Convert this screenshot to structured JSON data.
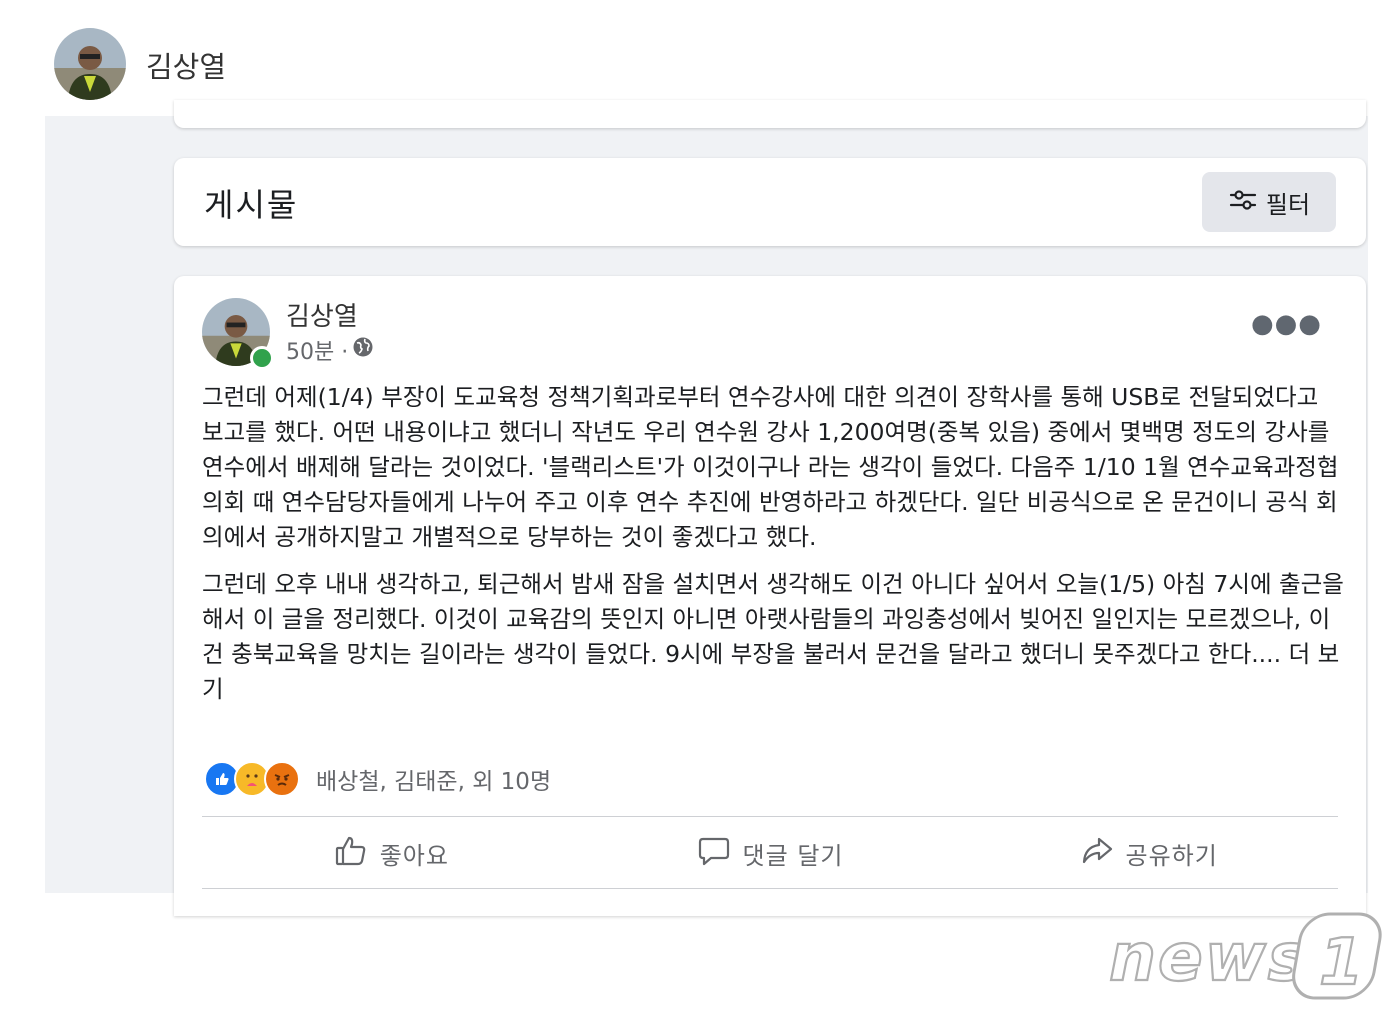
{
  "profile": {
    "name": "김상열"
  },
  "posts_section": {
    "title": "게시물",
    "filter_label": "필터"
  },
  "post": {
    "author": "김상열",
    "time": "50분 ·",
    "paragraphs": [
      "그런데 어제(1/4) 부장이 도교육청 정책기획과로부터 연수강사에 대한 의견이 장학사를 통해 USB로 전달되었다고 보고를 했다. 어떤 내용이냐고 했더니 작년도 우리 연수원 강사 1,200여명(중복 있음) 중에서 몇백명 정도의 강사를 연수에서 배제해 달라는 것이었다. '블랙리스트'가 이것이구나 라는 생각이 들었다. 다음주 1/10 1월 연수교육과정협의회 때 연수담당자들에게 나누어 주고 이후 연수 추진에 반영하라고 하겠단다. 일단 비공식으로 온 문건이니 공식 회의에서 공개하지말고 개별적으로 당부하는 것이 좋겠다고 했다.",
      "그런데 오후 내내 생각하고, 퇴근해서 밤새 잠을 설치면서 생각해도 이건 아니다 싶어서 오늘(1/5) 아침 7시에 출근을 해서 이 글을 정리했다. 이것이 교육감의 뜻인지 아니면 아랫사람들의 과잉충성에서 빚어진 일인지는 모르겠으나, 이건 충북교육을 망치는 길이라는 생각이 들었다. 9시에 부장을 불러서 문건을 달라고 했더니 못주겠다고 한다...."
    ],
    "see_more": "더 보기",
    "reactions_text": "배상철, 김태준, 외 10명",
    "actions": {
      "like": "좋아요",
      "comment": "댓글 달기",
      "share": "공유하기"
    }
  },
  "watermark": "news1",
  "colors": {
    "feed_bg": "#f0f2f5",
    "like_blue": "#1877f2",
    "online_green": "#31a24c",
    "secondary_text": "#65676b"
  }
}
